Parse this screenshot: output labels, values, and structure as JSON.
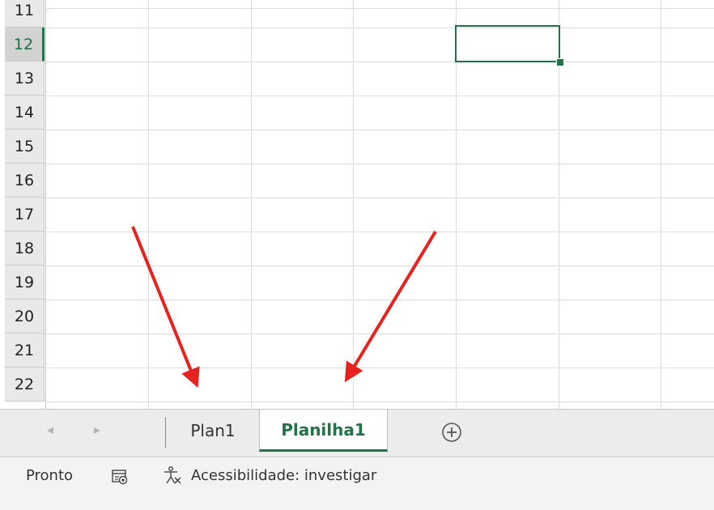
{
  "sheet": {
    "row_numbers": [
      "11",
      "12",
      "13",
      "14",
      "15",
      "16",
      "17",
      "18",
      "19",
      "20",
      "21",
      "22"
    ],
    "active_row": "12"
  },
  "tabs": {
    "prev_arrow": "◂",
    "next_arrow": "▸",
    "sheets": [
      {
        "label": "Plan1",
        "active": false
      },
      {
        "label": "Planilha1",
        "active": true
      }
    ],
    "add_icon": "plus-circle-icon"
  },
  "status": {
    "ready": "Pronto",
    "macro_icon": "macro-recorder-icon",
    "accessibility_icon": "accessibility-icon",
    "accessibility_label": "Acessibilidade: investigar"
  },
  "annotations": {
    "arrow_color": "#e8231f",
    "arrows": [
      "red-arrow-pointing-to-plan1-tab",
      "red-arrow-pointing-to-planilha1-tab"
    ]
  },
  "colors": {
    "excel_green": "#217346",
    "grid_line": "#dcdcdc",
    "header_bg": "#e9e9e9"
  }
}
